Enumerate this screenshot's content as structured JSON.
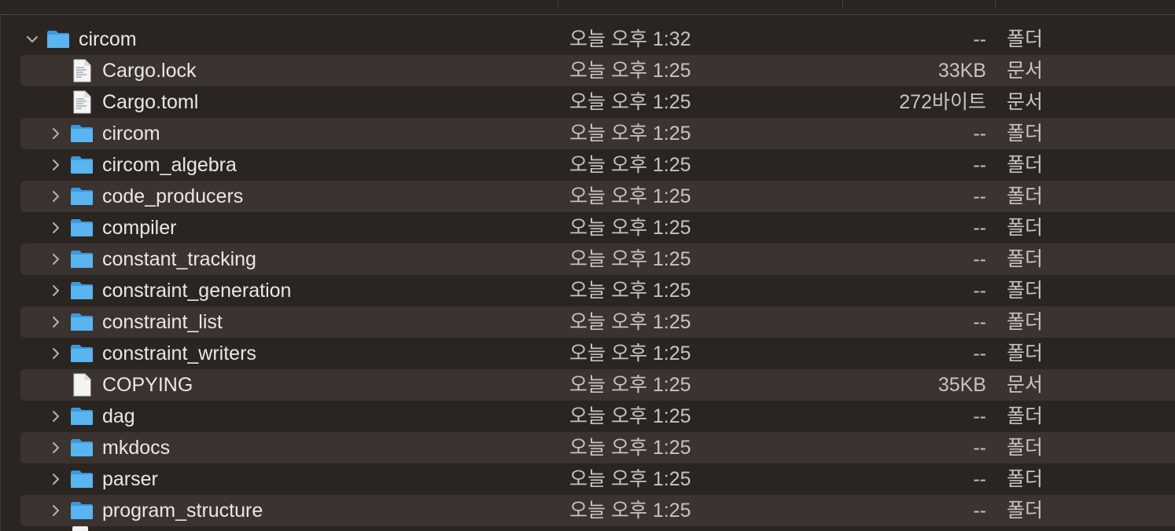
{
  "colors": {
    "background": "#2b2522",
    "row_alt": "#3a3330",
    "folder_blue": "#5ab4f0",
    "text": "#ebe7e4",
    "secondary_text": "#c9c3bf"
  },
  "rows": [
    {
      "name": "circom",
      "date": "오늘 오후 1:32",
      "size": "--",
      "kind": "폴더",
      "type": "folder",
      "expanded": true,
      "depth": 0
    },
    {
      "name": "Cargo.lock",
      "date": "오늘 오후 1:25",
      "size": "33KB",
      "kind": "문서",
      "type": "textfile",
      "depth": 1
    },
    {
      "name": "Cargo.toml",
      "date": "오늘 오후 1:25",
      "size": "272바이트",
      "kind": "문서",
      "type": "textfile",
      "depth": 1
    },
    {
      "name": "circom",
      "date": "오늘 오후 1:25",
      "size": "--",
      "kind": "폴더",
      "type": "folder",
      "expanded": false,
      "depth": 1
    },
    {
      "name": "circom_algebra",
      "date": "오늘 오후 1:25",
      "size": "--",
      "kind": "폴더",
      "type": "folder",
      "expanded": false,
      "depth": 1
    },
    {
      "name": "code_producers",
      "date": "오늘 오후 1:25",
      "size": "--",
      "kind": "폴더",
      "type": "folder",
      "expanded": false,
      "depth": 1
    },
    {
      "name": "compiler",
      "date": "오늘 오후 1:25",
      "size": "--",
      "kind": "폴더",
      "type": "folder",
      "expanded": false,
      "depth": 1
    },
    {
      "name": "constant_tracking",
      "date": "오늘 오후 1:25",
      "size": "--",
      "kind": "폴더",
      "type": "folder",
      "expanded": false,
      "depth": 1
    },
    {
      "name": "constraint_generation",
      "date": "오늘 오후 1:25",
      "size": "--",
      "kind": "폴더",
      "type": "folder",
      "expanded": false,
      "depth": 1
    },
    {
      "name": "constraint_list",
      "date": "오늘 오후 1:25",
      "size": "--",
      "kind": "폴더",
      "type": "folder",
      "expanded": false,
      "depth": 1
    },
    {
      "name": "constraint_writers",
      "date": "오늘 오후 1:25",
      "size": "--",
      "kind": "폴더",
      "type": "folder",
      "expanded": false,
      "depth": 1
    },
    {
      "name": "COPYING",
      "date": "오늘 오후 1:25",
      "size": "35KB",
      "kind": "문서",
      "type": "blankfile",
      "depth": 1
    },
    {
      "name": "dag",
      "date": "오늘 오후 1:25",
      "size": "--",
      "kind": "폴더",
      "type": "folder",
      "expanded": false,
      "depth": 1
    },
    {
      "name": "mkdocs",
      "date": "오늘 오후 1:25",
      "size": "--",
      "kind": "폴더",
      "type": "folder",
      "expanded": false,
      "depth": 1
    },
    {
      "name": "parser",
      "date": "오늘 오후 1:25",
      "size": "--",
      "kind": "폴더",
      "type": "folder",
      "expanded": false,
      "depth": 1
    },
    {
      "name": "program_structure",
      "date": "오늘 오후 1:25",
      "size": "--",
      "kind": "폴더",
      "type": "folder",
      "expanded": false,
      "depth": 1
    }
  ]
}
